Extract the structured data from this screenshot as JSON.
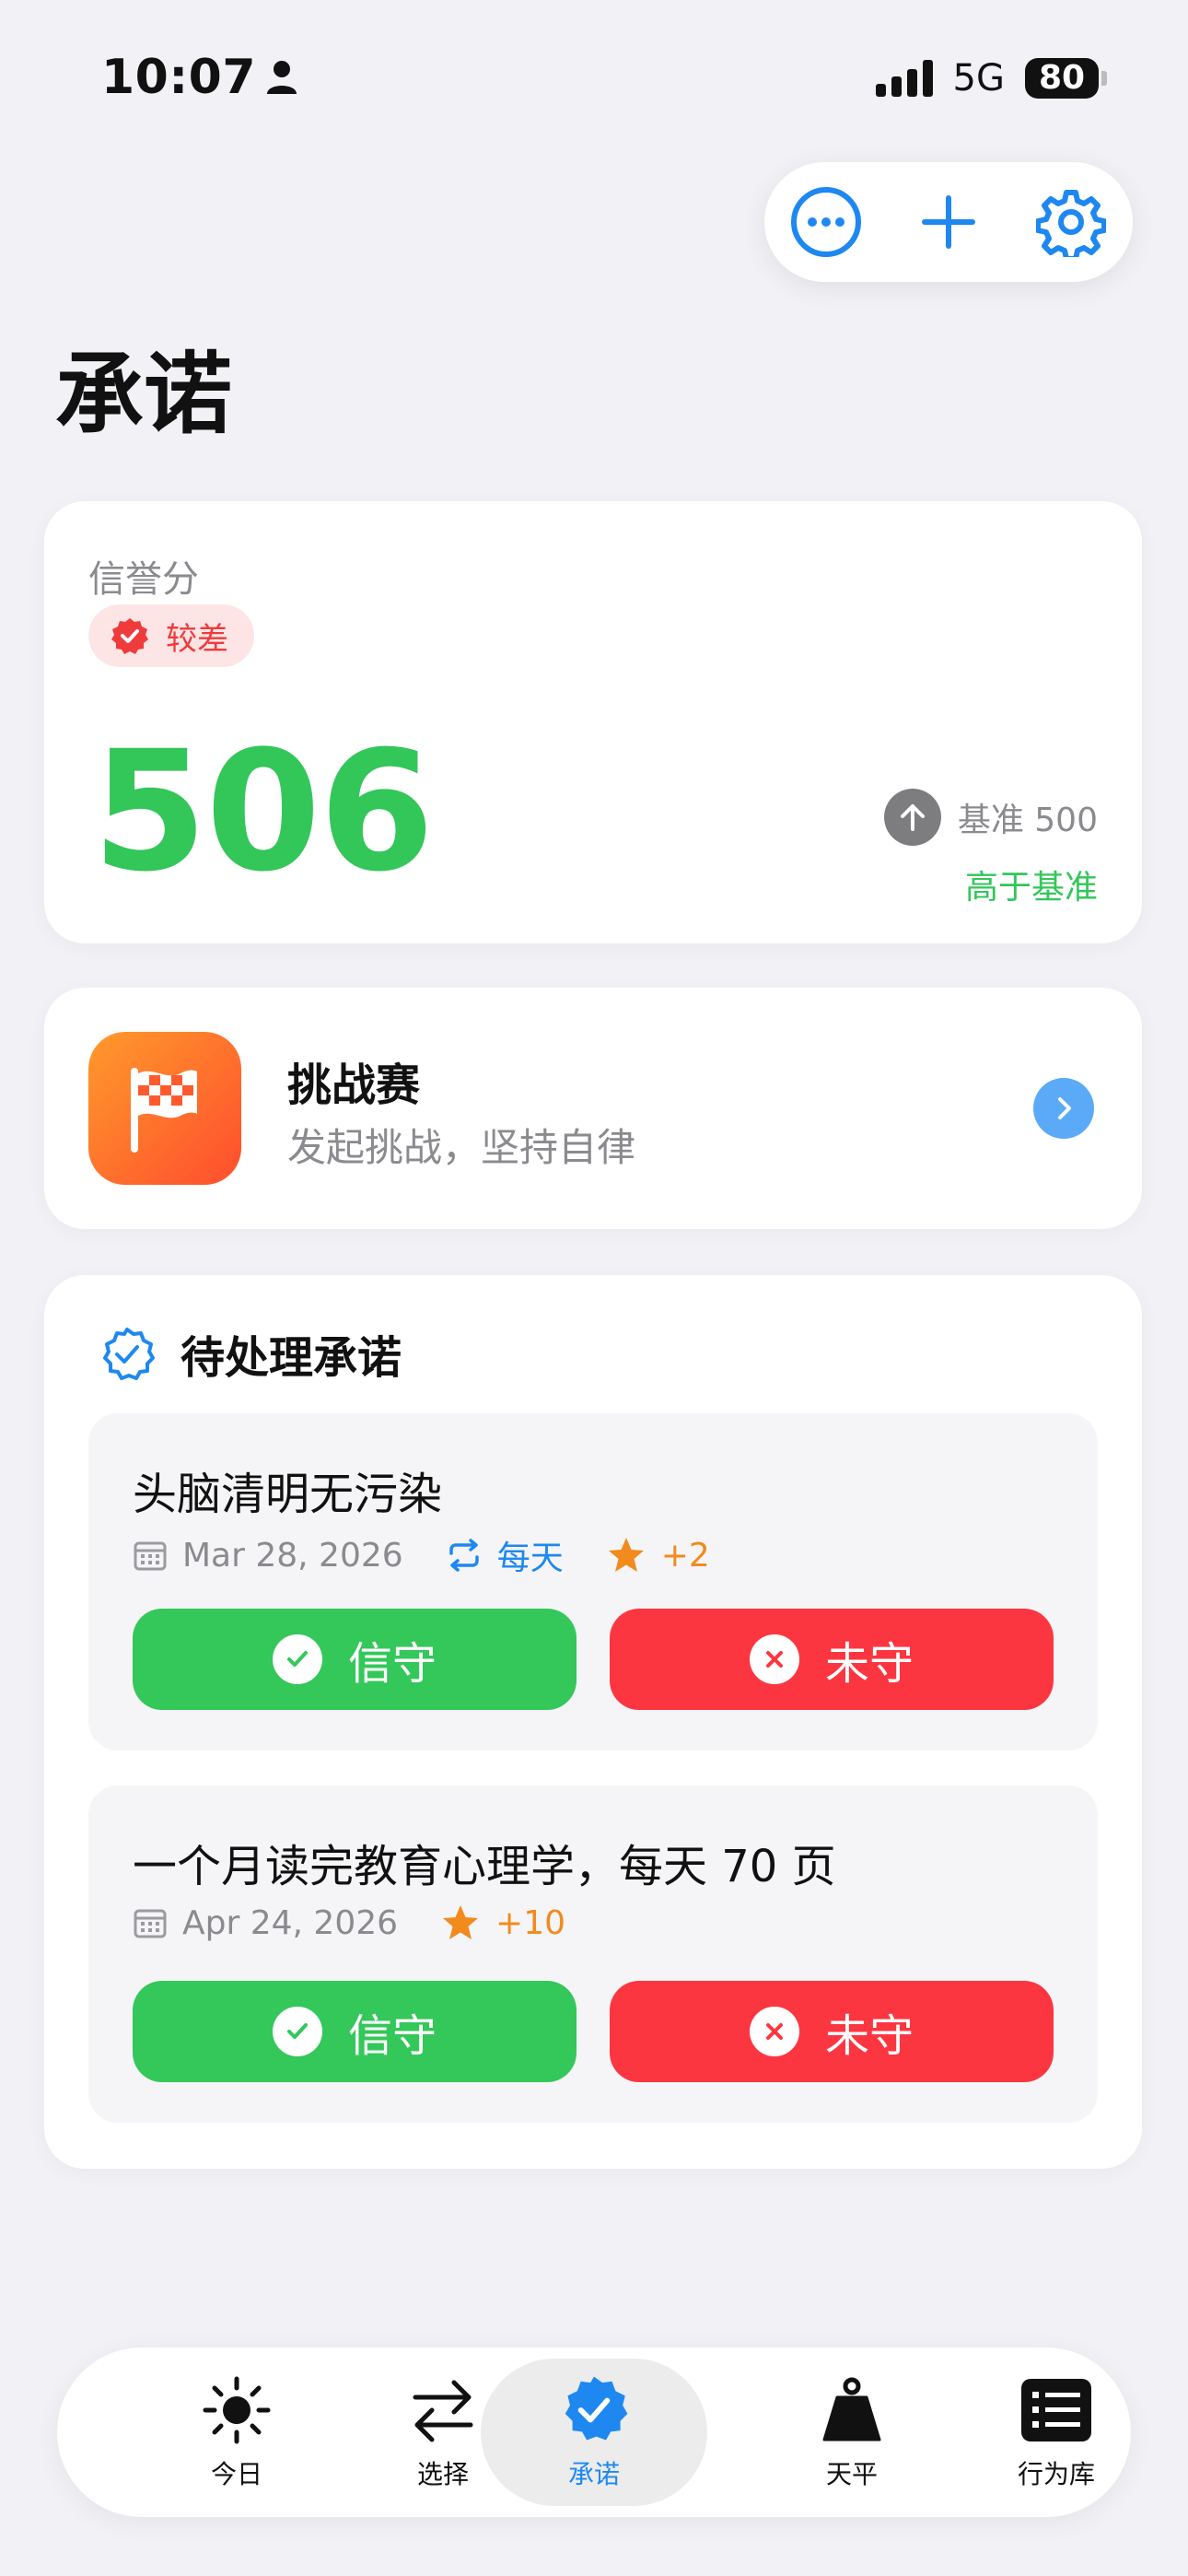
{
  "status_bar": {
    "time": "10:07",
    "network": "5G",
    "battery": "80"
  },
  "toolbar": {
    "more_icon": "ellipsis-circle-icon",
    "add_icon": "plus-icon",
    "settings_icon": "gear-icon"
  },
  "page": {
    "title": "承诺"
  },
  "credit": {
    "label": "信誉分",
    "badge": "较差",
    "score": "506",
    "baseline": "基准 500",
    "baseline_note": "高于基准"
  },
  "challenge": {
    "title": "挑战赛",
    "subtitle": "发起挑战，坚持自律"
  },
  "pending": {
    "title": "待处理承诺",
    "items": [
      {
        "title": "头脑清明无污染",
        "date": "Mar 28, 2026",
        "repeat": "每天",
        "points": "+2",
        "keep_label": "信守",
        "miss_label": "未守"
      },
      {
        "title": "一个月读完教育心理学，每天 70 页",
        "date": "Apr 24, 2026",
        "points": "+10",
        "keep_label": "信守",
        "miss_label": "未守"
      }
    ]
  },
  "tabbar": {
    "tabs": [
      {
        "label": "今日",
        "icon": "sun-icon"
      },
      {
        "label": "选择",
        "icon": "arrows-swap-icon"
      },
      {
        "label": "承诺",
        "icon": "seal-check-icon"
      },
      {
        "label": "天平",
        "icon": "weight-icon"
      },
      {
        "label": "行为库",
        "icon": "list-icon"
      }
    ],
    "active_index": 2
  },
  "colors": {
    "accent": "#1e88f0",
    "good": "#34c759",
    "bad": "#fc3640",
    "warn": "#f28a1d"
  }
}
